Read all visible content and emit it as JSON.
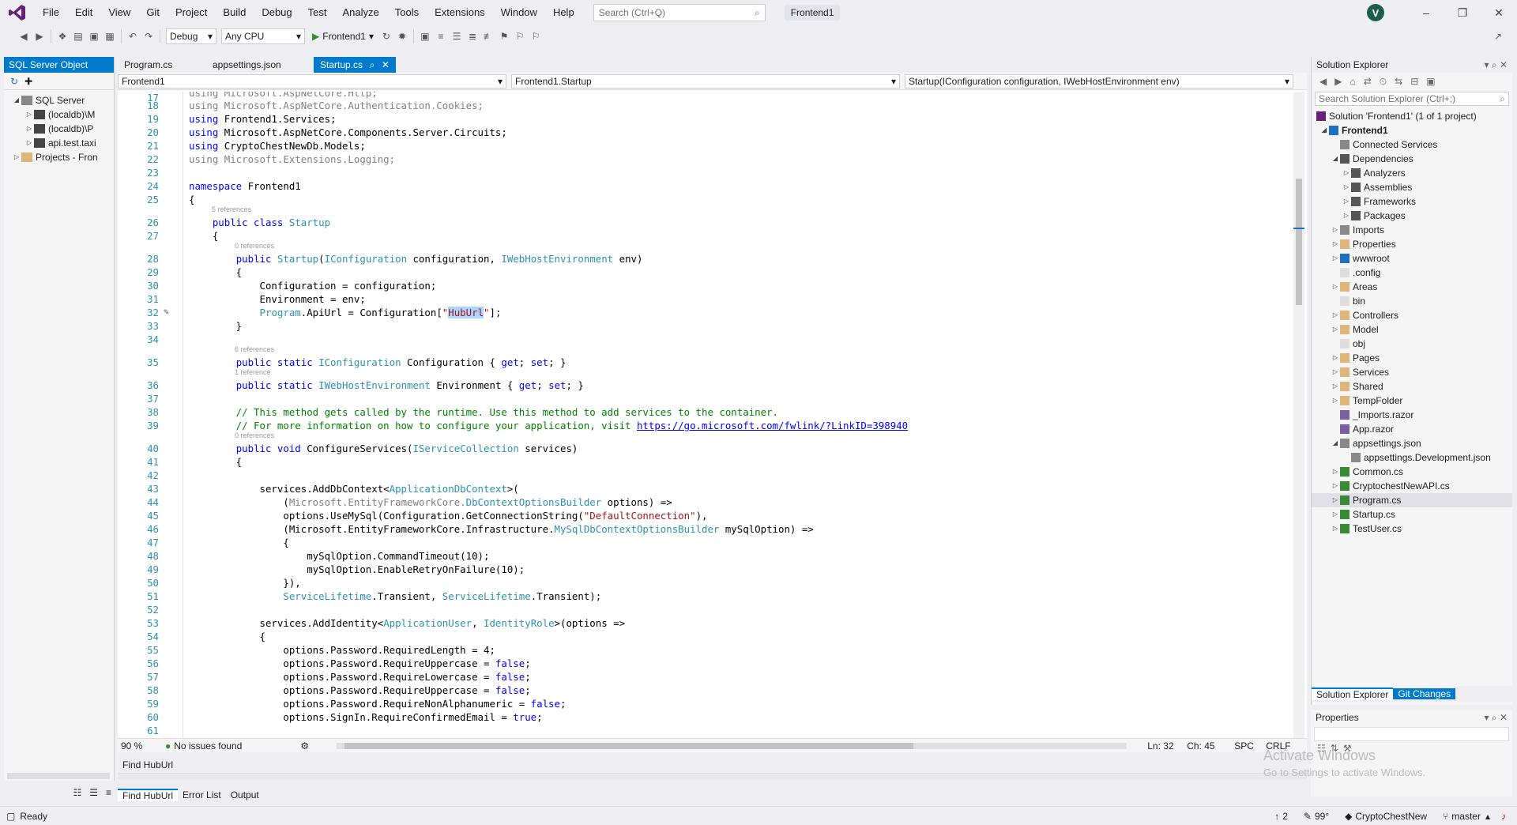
{
  "menu": [
    "File",
    "Edit",
    "View",
    "Git",
    "Project",
    "Build",
    "Debug",
    "Test",
    "Analyze",
    "Tools",
    "Extensions",
    "Window",
    "Help"
  ],
  "search": {
    "placeholder": "Search (Ctrl+Q)"
  },
  "project_badge": "Frontend1",
  "user_initial": "V",
  "toolbar": {
    "config": "Debug",
    "platform": "Any CPU",
    "run_target": "Frontend1"
  },
  "sql_panel": {
    "title": "SQL Server Object Expl...",
    "items": [
      "SQL Server",
      "(localdb)\\M",
      "(localdb)\\P",
      "api.test.taxi",
      "Projects - Fron"
    ]
  },
  "tabs": [
    "Program.cs",
    "appsettings.json",
    "Startup.cs"
  ],
  "nav": {
    "project": "Frontend1",
    "type": "Frontend1.Startup",
    "member": "Startup(IConfiguration configuration, IWebHostEnvironment env)"
  },
  "code": {
    "line17": "17",
    "line18": "18",
    "line19": "19",
    "line20": "20",
    "line21": "21",
    "line22": "22",
    "line23": "23",
    "line24": "24",
    "line25": "25",
    "line26": "26",
    "line27": "27",
    "line28": "28",
    "line29": "29",
    "line30": "30",
    "line31": "31",
    "line32": "32",
    "line33": "33",
    "line34": "34",
    "line35": "35",
    "line36": "36",
    "line37": "37",
    "line38": "38",
    "line39": "39",
    "line40": "40",
    "line41": "41",
    "line42": "42",
    "line43": "43",
    "line44": "44",
    "line45": "45",
    "line46": "46",
    "line47": "47",
    "line48": "48",
    "line49": "49",
    "line50": "50",
    "line51": "51",
    "line52": "52",
    "line53": "53",
    "line54": "54",
    "line55": "55",
    "line56": "56",
    "line57": "57",
    "line58": "58",
    "line59": "59",
    "line60": "60",
    "line61": "61",
    "ref5": "5 references",
    "ref0": "0 references",
    "ref6": "6 references",
    "ref1": "1 reference",
    "link": "https://go.microsoft.com/fwlink/?LinkID=398940"
  },
  "status": {
    "zoom": "90 %",
    "issues": "No issues found",
    "ln": "Ln: 32",
    "ch": "Ch: 45",
    "spc": "SPC",
    "crlf": "CRLF"
  },
  "find_panel": {
    "title": "Find HubUrl",
    "tabs": [
      "Find HubUrl",
      "Error List",
      "Output"
    ]
  },
  "solution": {
    "title": "Solution Explorer",
    "search_placeholder": "Search Solution Explorer (Ctrl+;)",
    "root": "Solution 'Frontend1' (1 of 1 project)",
    "project": "Frontend1",
    "items": [
      "Connected Services",
      "Dependencies",
      "Analyzers",
      "Assemblies",
      "Frameworks",
      "Packages",
      "Imports",
      "Properties",
      "wwwroot",
      ".config",
      "Areas",
      "bin",
      "Controllers",
      "Model",
      "obj",
      "Pages",
      "Services",
      "Shared",
      "TempFolder",
      "_Imports.razor",
      "App.razor",
      "appsettings.json",
      "appsettings.Development.json",
      "Common.cs",
      "CryptochestNewAPI.cs",
      "Program.cs",
      "Startup.cs",
      "TestUser.cs"
    ],
    "bottom_tabs": [
      "Solution Explorer",
      "Git Changes"
    ]
  },
  "properties": {
    "title": "Properties"
  },
  "watermark": {
    "line1": "Activate Windows",
    "line2": "Go to Settings to activate Windows."
  },
  "statusbar": {
    "ready": "Ready",
    "errors": "2",
    "pencil": "99°",
    "repo": "CryptoChestNew",
    "branch": "master"
  }
}
